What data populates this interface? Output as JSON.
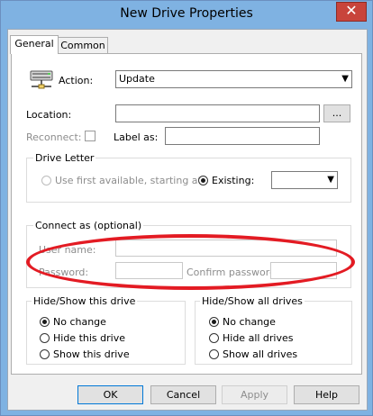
{
  "window": {
    "title": "New Drive Properties",
    "close_glyph": "✕"
  },
  "tabs": [
    {
      "label": "General",
      "active": true
    },
    {
      "label": "Common",
      "active": false
    }
  ],
  "action": {
    "label": "Action:",
    "value": "Update",
    "icon": "network-drive-icon"
  },
  "location": {
    "label": "Location:",
    "value": "",
    "browse_label": "..."
  },
  "reconnect": {
    "label": "Reconnect:",
    "checked": false
  },
  "label_as": {
    "label": "Label as:",
    "value": ""
  },
  "drive_letter": {
    "title": "Drive Letter",
    "first_available_label": "Use first available, starting at:",
    "existing_label": "Existing:",
    "selected": "existing",
    "existing_value": ""
  },
  "connect_as": {
    "title": "Connect as (optional)",
    "user_name_label": "User name:",
    "password_label": "Password:",
    "confirm_password_label": "Confirm password:"
  },
  "hide_show_drive": {
    "title": "Hide/Show this drive",
    "options": [
      "No change",
      "Hide this drive",
      "Show this drive"
    ],
    "selected": 0
  },
  "hide_show_all": {
    "title": "Hide/Show all drives",
    "options": [
      "No change",
      "Hide all drives",
      "Show all drives"
    ],
    "selected": 0
  },
  "buttons": {
    "ok": "OK",
    "cancel": "Cancel",
    "apply": "Apply",
    "help": "Help"
  },
  "colors": {
    "title_bar": "#7fb2e2",
    "close_button": "#c8443b",
    "highlight_ring": "#e31b23"
  }
}
